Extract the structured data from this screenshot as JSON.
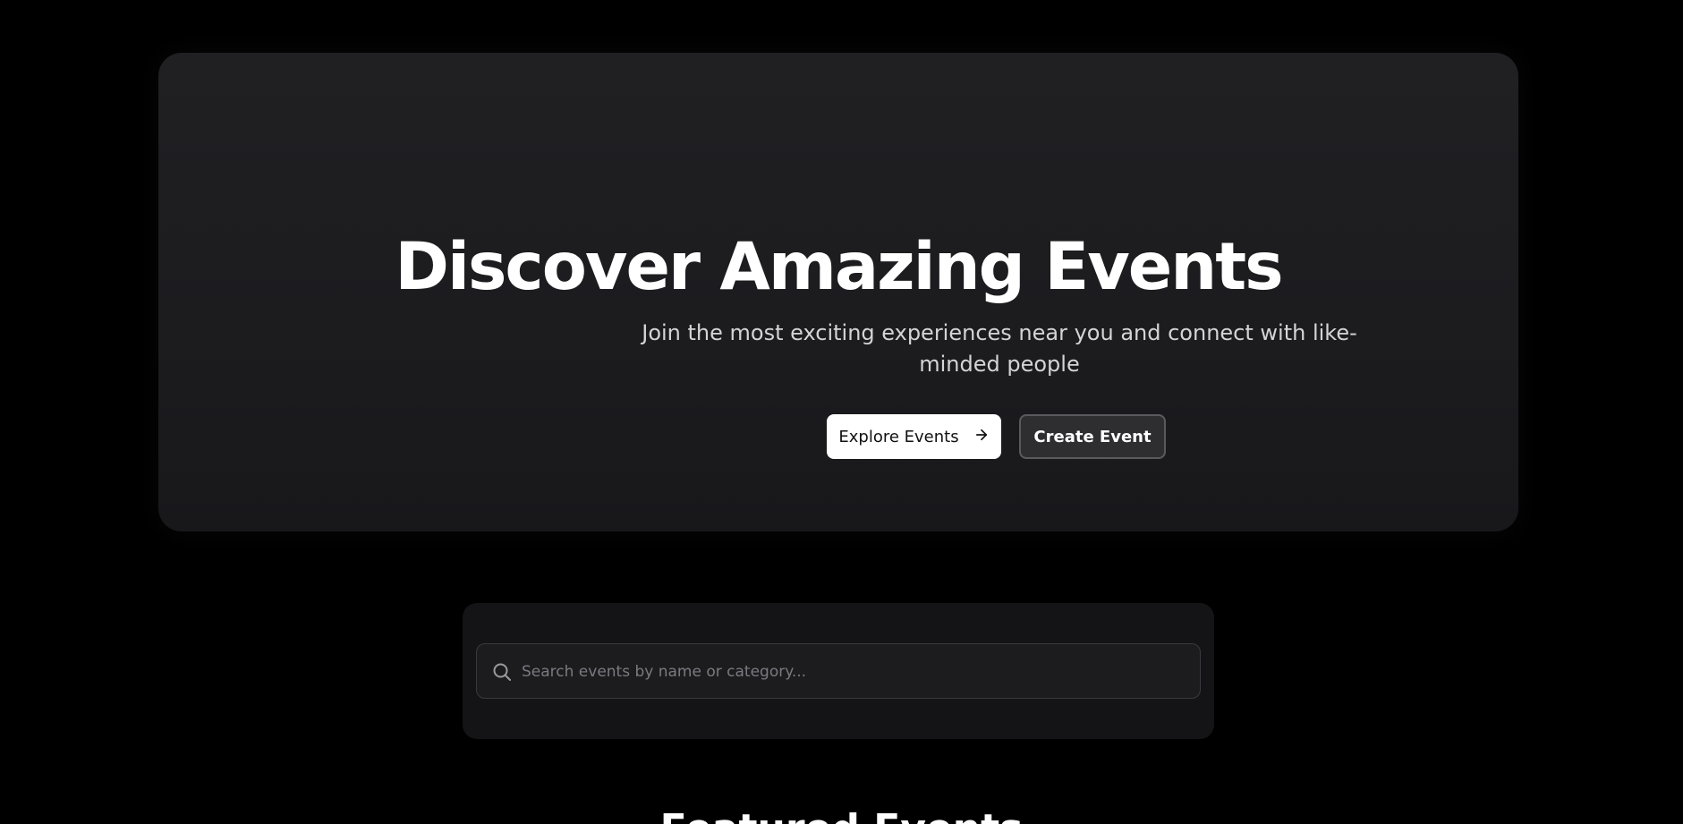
{
  "hero": {
    "title": "Discover Amazing Events",
    "subtitle": "Join the most exciting experiences near you and connect with like-minded people",
    "explore_label": "Explore Events",
    "explore_icon": "arrow-right-icon",
    "create_label": "Create Event"
  },
  "search": {
    "placeholder": "Search events by name or category...",
    "value": "",
    "icon": "search-icon"
  },
  "featured": {
    "title": "Featured Events"
  },
  "colors": {
    "page_background": "#000000",
    "hero_background": "#1e1e21",
    "primary_button": "#ffffff",
    "secondary_button": "#2e2e31"
  }
}
